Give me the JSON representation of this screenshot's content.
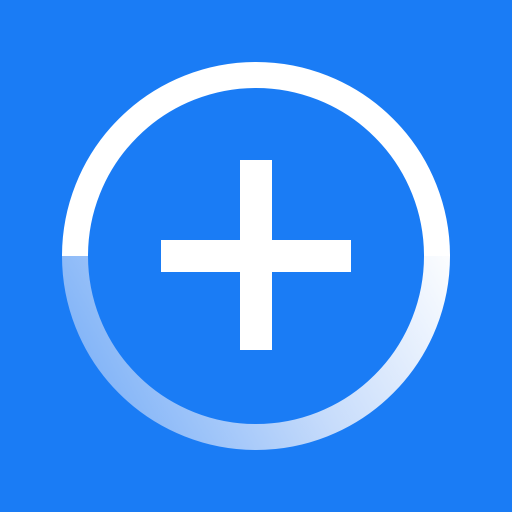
{
  "icon": {
    "name": "add-icon",
    "background_color": "#1a7cf5",
    "ring_color": "#ffffff",
    "plus_color": "#ffffff",
    "ring_fade_color": "#6fa9f7"
  }
}
